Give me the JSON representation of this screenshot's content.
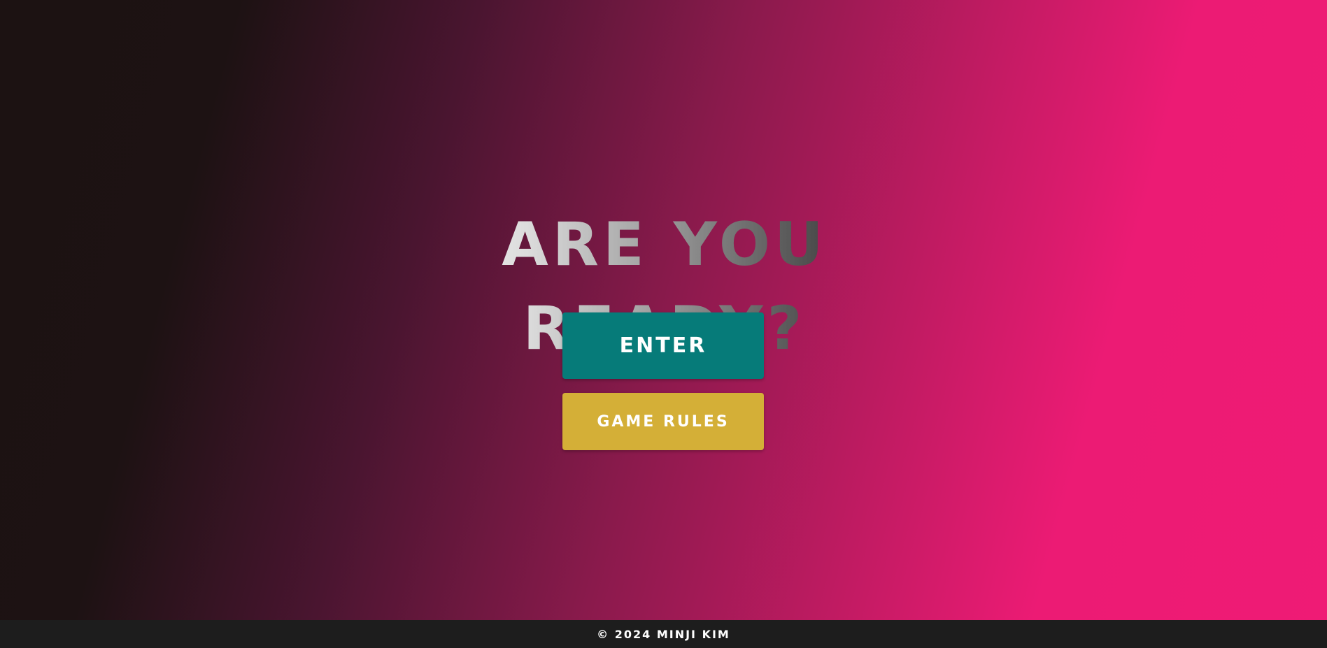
{
  "hero": {
    "headline": "Are you ready?"
  },
  "buttons": {
    "enter_label": "Enter",
    "rules_label": "Game Rules"
  },
  "footer": {
    "text": "© 2024 Minji Kim"
  },
  "colors": {
    "enter_button": "#067b79",
    "rules_button": "#d4af37",
    "footer_bg": "#1d1d1d",
    "gradient_dark": "#1c1212",
    "gradient_pink": "#ef1b75"
  }
}
